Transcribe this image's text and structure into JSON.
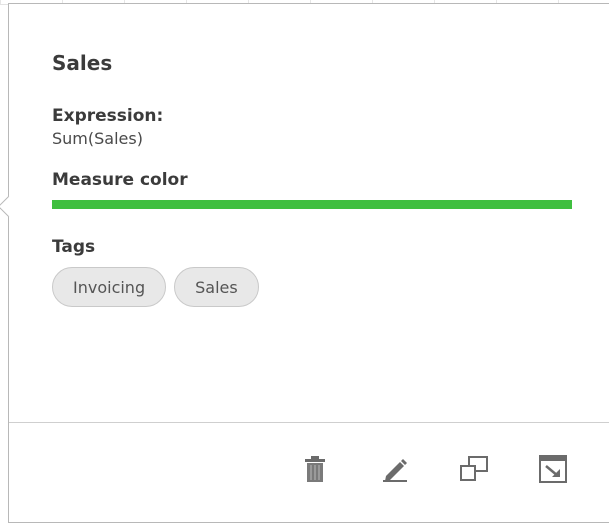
{
  "panel": {
    "title": "Sales",
    "expression_label": "Expression:",
    "expression_value": "Sum(Sales)",
    "color_label": "Measure color",
    "measure_color": "#3fbf3f",
    "tags_label": "Tags",
    "tags": [
      "Invoicing",
      "Sales"
    ]
  },
  "footer": {
    "actions": [
      {
        "name": "delete",
        "icon": "trash-icon"
      },
      {
        "name": "edit",
        "icon": "pencil-icon"
      },
      {
        "name": "duplicate",
        "icon": "duplicate-icon"
      },
      {
        "name": "expand",
        "icon": "expand-icon"
      }
    ]
  }
}
